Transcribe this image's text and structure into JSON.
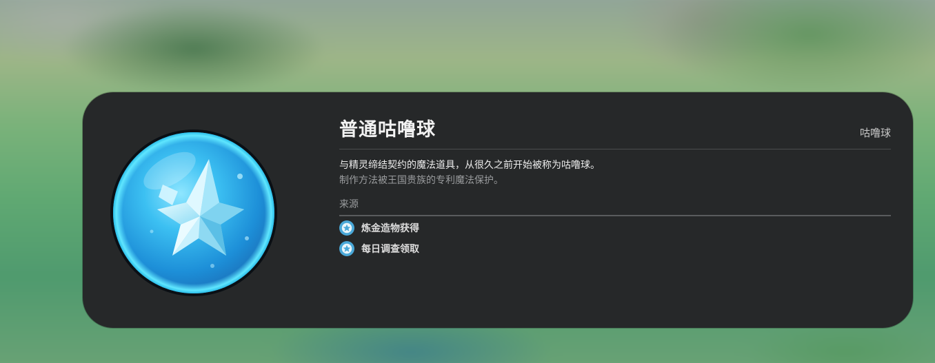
{
  "item": {
    "name": "普通咕噜球",
    "category": "咕噜球",
    "description_primary": "与精灵缔结契约的魔法道具，从很久之前开始被称为咕噜球。",
    "description_secondary": "制作方法被王国贵族的专利魔法保护。",
    "icon": "blue-star-orb-icon"
  },
  "source": {
    "label": "来源",
    "items": [
      {
        "label": "炼金造物获得",
        "icon": "source-badge-icon"
      },
      {
        "label": "每日调查领取",
        "icon": "source-badge-icon"
      }
    ]
  },
  "colors": {
    "panel": "#262829",
    "orb_primary": "#2fb8f0",
    "orb_rim": "#5fe3ff",
    "badge": "#4aa8d8"
  }
}
